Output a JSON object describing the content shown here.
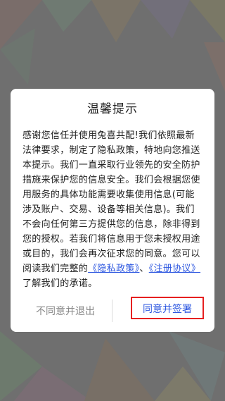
{
  "dialog": {
    "title": "温馨提示",
    "body_intro": "感谢您信任并使用兔喜共配!我们依照最新法律要求，制定了隐私政策，特地向您推送本提示。我们一直采取行业领先的安全防护措施来保护您的信息安全。我们会根据您使用服务的具体功能需要收集使用信息(可能涉及账户、交易、设备等相关信息)。我们不会向任何第三方提供您的信息，除非得到您的授权。若我们将信息用于您未授权用途或目的，我们会再次征求您的同意。您可以阅读我们完整的",
    "privacy_link": "《隐私政策》",
    "separator": "、",
    "register_link": "《注册协议》",
    "body_outro": "了解我们的承诺。",
    "decline_label": "不同意并退出",
    "accept_label": "同意并签署"
  },
  "colors": {
    "link": "#2d57e0",
    "accept_text": "#2d57e0",
    "accept_outline": "#e62020",
    "decline_text": "#888888"
  }
}
